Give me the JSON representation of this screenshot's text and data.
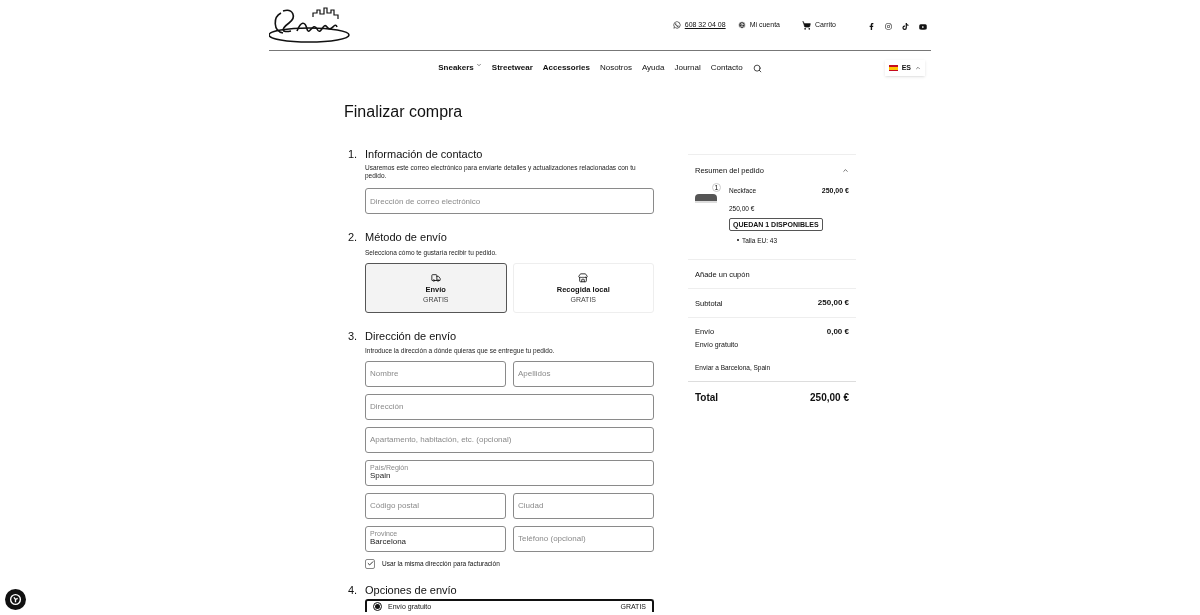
{
  "header": {
    "phone": "608 32 04 08",
    "account": "Mi cuenta",
    "cart": "Carrito"
  },
  "nav": [
    {
      "label": "Sneakers",
      "bold": true,
      "dropdown": true
    },
    {
      "label": "Streetwear",
      "bold": true,
      "dropdown": false
    },
    {
      "label": "Accessories",
      "bold": true,
      "dropdown": false
    },
    {
      "label": "Nosotros",
      "bold": false,
      "dropdown": false
    },
    {
      "label": "Ayuda",
      "bold": false,
      "dropdown": false
    },
    {
      "label": "Journal",
      "bold": false,
      "dropdown": false
    },
    {
      "label": "Contacto",
      "bold": false,
      "dropdown": false
    }
  ],
  "language": {
    "code": "ES",
    "expanded": true
  },
  "page_title": "Finalizar compra",
  "contact": {
    "number": "1.",
    "title": "Información de contacto",
    "description": "Usaremos este correo electrónico para enviarte detalles y actualizaciones relacionadas con tu pedido.",
    "email_placeholder": "Dirección de correo electrónico"
  },
  "method": {
    "number": "2.",
    "title": "Método de envío",
    "description": "Selecciona cómo te gustaría recibir tu pedido.",
    "options": [
      {
        "kind": "truck",
        "label": "Envío",
        "price": "GRATIS",
        "selected": true
      },
      {
        "kind": "store",
        "label": "Recogida local",
        "price": "GRATIS",
        "selected": false
      }
    ]
  },
  "address": {
    "number": "3.",
    "title": "Dirección de envío",
    "description": "Introduce la dirección a dónde quieras que se entregue tu pedido.",
    "rows": [
      [
        {
          "placeholder": "Nombre"
        },
        {
          "placeholder": "Apellidos"
        }
      ],
      [
        {
          "placeholder": "Dirección"
        }
      ],
      [
        {
          "placeholder": "Apartamento, habitación, etc. (opcional)"
        }
      ],
      [
        {
          "label": "País/Región",
          "value": "Spain"
        }
      ],
      [
        {
          "placeholder": "Código postal"
        },
        {
          "placeholder": "Ciudad"
        }
      ],
      [
        {
          "label": "Province",
          "value": "Barcelona"
        },
        {
          "placeholder": "Teléfono (opcional)"
        }
      ]
    ],
    "billing": {
      "label": "Usar la misma dirección para facturación",
      "checked": true
    }
  },
  "options": {
    "number": "4.",
    "title": "Opciones de envío",
    "items": [
      {
        "label": "Envío gratuito",
        "price": "GRATIS",
        "selected": true
      }
    ]
  },
  "summary": {
    "title": "Resumen del pedido",
    "expanded": true,
    "item": {
      "quantity": "1",
      "name": "Neckface",
      "total": "250,00 €",
      "price": "250,00 €",
      "stock": "QUEDAN 1 DISPONIBLES",
      "details": [
        "Talla EU: 43"
      ]
    },
    "coupon": "Añade un cupón",
    "subtotal": {
      "label": "Subtotal",
      "value": "250,00 €"
    },
    "shipping": {
      "label": "Envío",
      "value": "0,00 €",
      "note": "Envío gratuito",
      "destination": "Enviar a Barcelona, Spain"
    },
    "total": {
      "label": "Total",
      "value": "250,00 €"
    }
  }
}
